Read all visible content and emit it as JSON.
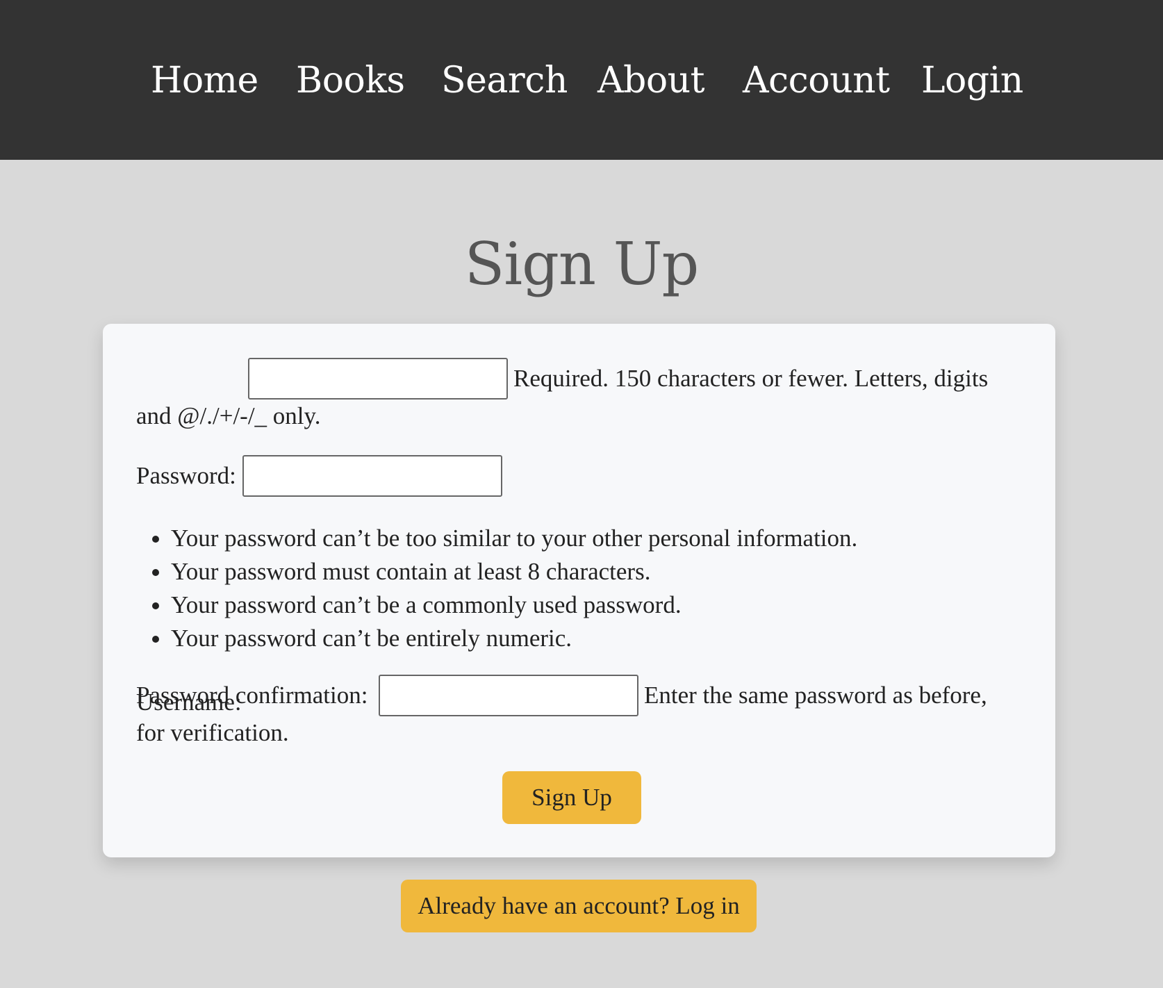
{
  "nav": {
    "items": [
      {
        "label": "Home"
      },
      {
        "label": "Books"
      },
      {
        "label": "Search"
      },
      {
        "label": "About"
      },
      {
        "label": "Account"
      },
      {
        "label": "Login"
      }
    ]
  },
  "page": {
    "title": "Sign Up"
  },
  "form": {
    "username_label": "Username:",
    "username_value": "",
    "username_help_1": "Required. 150 characters or fewer. Letters, digits",
    "username_help_2": "and @/./+/-/_ only.",
    "password_label": "Password:",
    "password_value": "",
    "password_rules": [
      "Your password can’t be too similar to your other personal information.",
      "Your password must contain at least 8 characters.",
      "Your password can’t be a commonly used password.",
      "Your password can’t be entirely numeric."
    ],
    "confirm_label": "Password confirmation:",
    "confirm_value": "",
    "confirm_help_1": "Enter the same password as before,",
    "confirm_help_2": "for verification.",
    "submit_label": "Sign Up"
  },
  "login_link": {
    "label": "Already have an account? Log in"
  },
  "colors": {
    "navbar": "#333333",
    "page_background": "#d9d9d9",
    "card_background": "#f7f8fa",
    "button_accent": "#f0b83c",
    "title_text": "#555555"
  }
}
